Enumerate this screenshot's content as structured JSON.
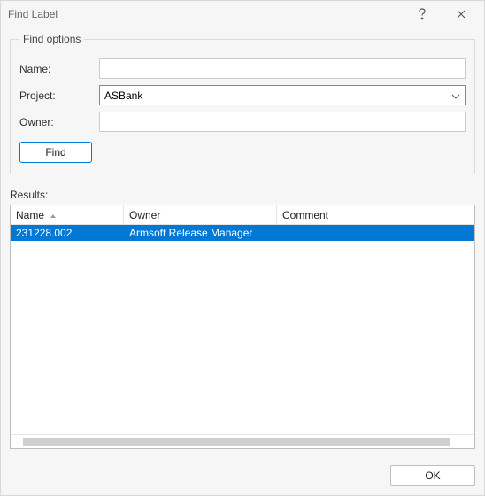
{
  "window": {
    "title": "Find Label"
  },
  "findOptions": {
    "legend": "Find options",
    "nameLabel": "Name:",
    "nameValue": "",
    "projectLabel": "Project:",
    "projectSelected": "ASBank",
    "ownerLabel": "Owner:",
    "ownerValue": "",
    "findButton": "Find"
  },
  "results": {
    "label": "Results:",
    "columns": {
      "name": "Name",
      "owner": "Owner",
      "comment": "Comment"
    },
    "rows": [
      {
        "name": "231228.002",
        "owner": "Armsoft Release Manager",
        "comment": ""
      }
    ],
    "selectedIndex": 0
  },
  "footer": {
    "ok": "OK"
  }
}
